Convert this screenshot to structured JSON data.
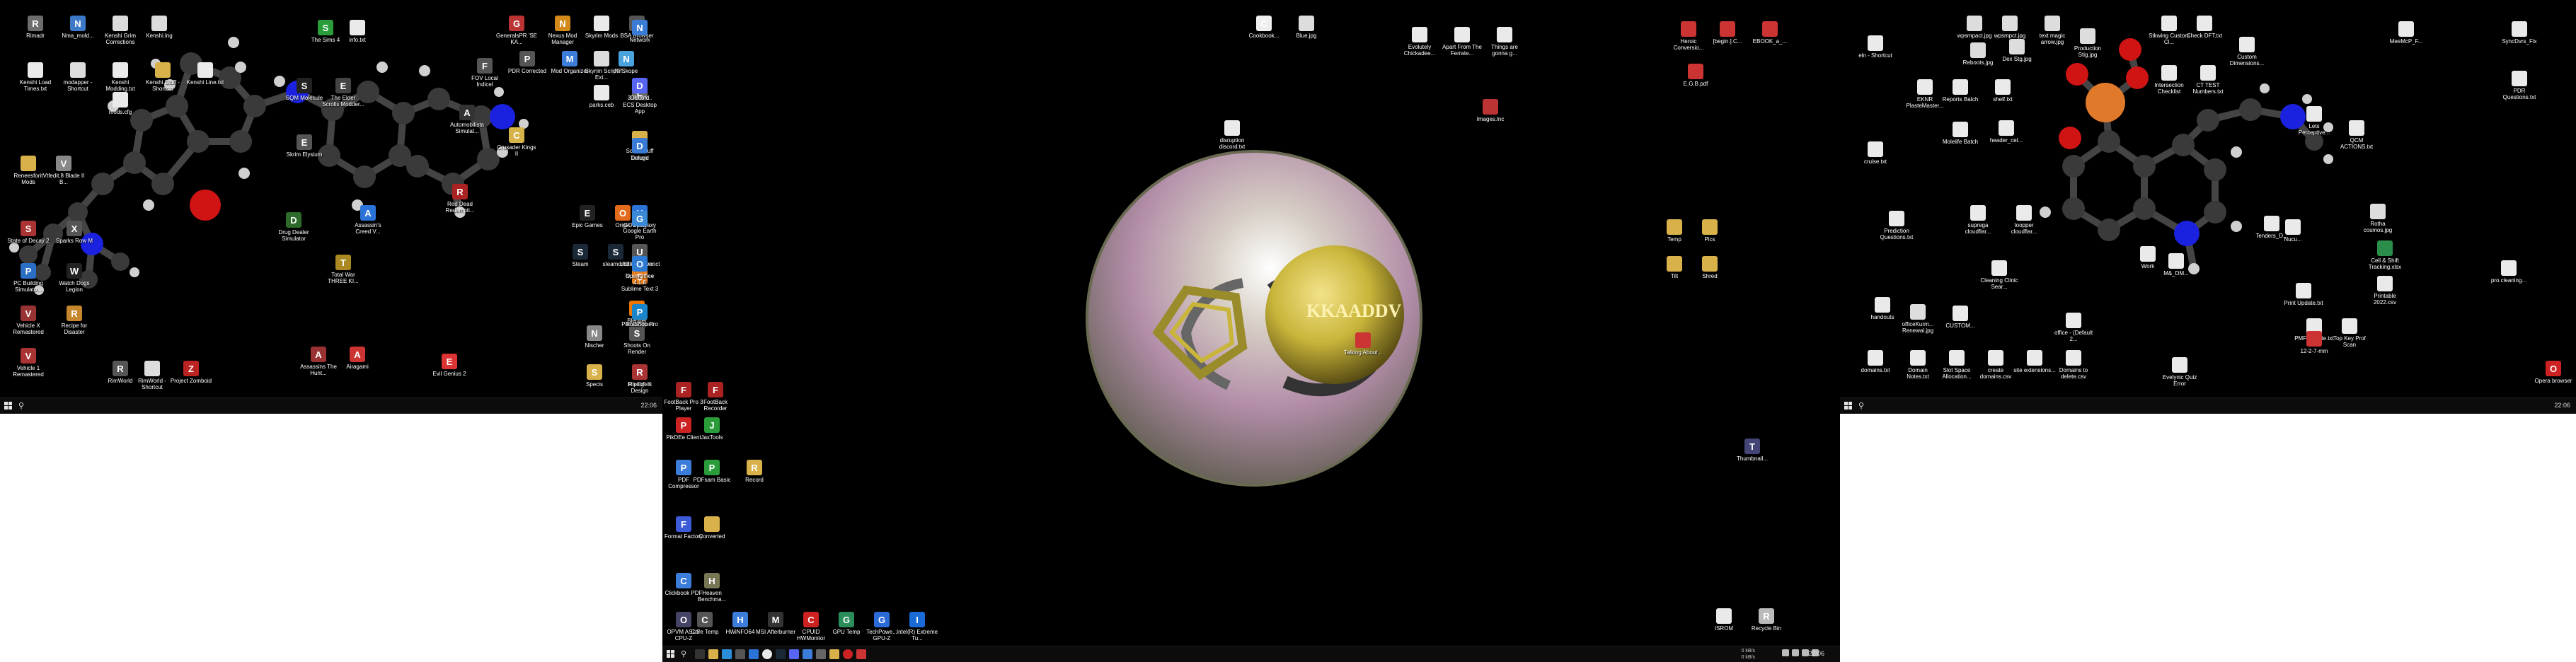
{
  "taskbars": {
    "left_clock": "22:06",
    "center_clock": "22:06",
    "right_clock": "22:06",
    "net_up": "0 kB/s",
    "net_down": "0 kB/s"
  },
  "left_icons": [
    {
      "label": "Rimadr",
      "name": "rimadr",
      "color": "#6d6d6d",
      "glyph": "R"
    },
    {
      "label": "Nma_mold...",
      "name": "nma-mold",
      "color": "#3c7ac9",
      "glyph": "N"
    },
    {
      "label": "Kenshi Grim Corrections",
      "name": "kenshi-grim",
      "color": "#dcdcdc",
      "glyph": ""
    },
    {
      "label": "Kenshi.lng",
      "name": "kenshi-lng",
      "color": "#dcdcdc",
      "glyph": ""
    },
    {
      "label": "Kenshi Load Times.txt",
      "name": "kenshi-load-times",
      "color": "#eaeaea",
      "glyph": ""
    },
    {
      "label": "modapper - Shortcut",
      "name": "modapper",
      "color": "#dcdcdc",
      "glyph": ""
    },
    {
      "label": "Kenshi Modding.txt",
      "name": "kenshi-modding",
      "color": "#eaeaea",
      "glyph": ""
    },
    {
      "label": "Kenshi Stuff - Shortcut",
      "name": "kenshi-stuff",
      "color": "#d8b14a",
      "glyph": ""
    },
    {
      "label": "Kenshi Line.txt",
      "name": "kenshi-line",
      "color": "#eaeaea",
      "glyph": ""
    },
    {
      "label": "mods.cfg",
      "name": "mods-cfg",
      "color": "#eaeaea",
      "glyph": ""
    },
    {
      "label": "Reneesforit Mods",
      "name": "reneesforit-mods",
      "color": "#d8b14a",
      "glyph": ""
    },
    {
      "label": "Vtfedit.8 Blade II B...",
      "name": "vtfedit",
      "color": "#888",
      "glyph": "V"
    },
    {
      "label": "State of Decay 2",
      "name": "state-of-decay",
      "color": "#a33",
      "glyph": "S"
    },
    {
      "label": "Sparks Row M",
      "name": "sparks-row",
      "color": "#555",
      "glyph": "X"
    },
    {
      "label": "PC Building Simulato...",
      "name": "pc-building-sim",
      "color": "#2b6fc4",
      "glyph": "P"
    },
    {
      "label": "Watch Dogs Legion",
      "name": "watch-dogs",
      "color": "#222",
      "glyph": "W"
    },
    {
      "label": "Vehicle X Remastered",
      "name": "vehicle-x",
      "color": "#933",
      "glyph": "V"
    },
    {
      "label": "Recipe for Disaster",
      "name": "recipe-disaster",
      "color": "#c6862e",
      "glyph": "R"
    },
    {
      "label": "Vehicle 1 Remastered",
      "name": "vehicle-1",
      "color": "#a33",
      "glyph": "V"
    },
    {
      "label": "RimWorld",
      "name": "rimworld",
      "color": "#555",
      "glyph": "R"
    },
    {
      "label": "RimWorld - Shortcut",
      "name": "rimworld-shortcut",
      "color": "#ddd",
      "glyph": ""
    },
    {
      "label": "Project Zomboid",
      "name": "project-zomboid",
      "color": "#b22",
      "glyph": "Z"
    },
    {
      "label": "The Sims 4",
      "name": "the-sims-4",
      "color": "#2a9d3a",
      "glyph": "S"
    },
    {
      "label": "info.txt",
      "name": "info-txt",
      "color": "#eaeaea",
      "glyph": ""
    },
    {
      "label": "SQM Molecule",
      "name": "sqm-molecule",
      "color": "#222",
      "glyph": "S"
    },
    {
      "label": "The Elder Scrolls Modder...",
      "name": "elder-scrolls",
      "color": "#444",
      "glyph": "E"
    },
    {
      "label": "Skrim Elysium",
      "name": "skrim-elysium",
      "color": "#555",
      "glyph": "E"
    },
    {
      "label": "Drug Dealer Simulator",
      "name": "drug-dealer",
      "color": "#2d6b2a",
      "glyph": "D"
    },
    {
      "label": "Assassin's Creed V...",
      "name": "assassins-creed",
      "color": "#2b73d8",
      "glyph": "A"
    },
    {
      "label": "Total War THREE KI...",
      "name": "total-war",
      "color": "#a82",
      "glyph": "T"
    },
    {
      "label": "Assassins The Hunt...",
      "name": "assassins-hunt",
      "color": "#933",
      "glyph": "A"
    },
    {
      "label": "Airagami",
      "name": "airagami",
      "color": "#c33",
      "glyph": "A"
    },
    {
      "label": "GeneralsPR 'SE KA...",
      "name": "generals-pr",
      "color": "#b33",
      "glyph": "G"
    },
    {
      "label": "Nexus Mod Manager",
      "name": "nexus-mod",
      "color": "#d48a1b",
      "glyph": "N"
    },
    {
      "label": "Skyrim Mods",
      "name": "skyrim-mods",
      "color": "#eaeaea",
      "glyph": ""
    },
    {
      "label": "BSA Browser",
      "name": "bsa-browser",
      "color": "#555",
      "glyph": "B"
    },
    {
      "label": "FOV Local Indicel",
      "name": "fov-local",
      "color": "#555",
      "glyph": "F"
    },
    {
      "label": "PDR Corrected",
      "name": "pdr-corrected",
      "color": "#555",
      "glyph": "P"
    },
    {
      "label": "Mod Organizer",
      "name": "mod-organizer",
      "color": "#3b7dd8",
      "glyph": "M"
    },
    {
      "label": "Skyrim Script Ext...",
      "name": "skyrim-script",
      "color": "#ddd",
      "glyph": ""
    },
    {
      "label": "NifSkope",
      "name": "nifskope",
      "color": "#4aa3df",
      "glyph": "N"
    },
    {
      "label": "parks.ceb",
      "name": "parks-ceb",
      "color": "#eaeaea",
      "glyph": ""
    },
    {
      "label": "Automobilista Simulat...",
      "name": "automobilista",
      "color": "#333",
      "glyph": "A"
    },
    {
      "label": "Crusader Kings II",
      "name": "crusader-kings",
      "color": "#d7b44a",
      "glyph": "C"
    },
    {
      "label": "Red Dead Redempti...",
      "name": "red-dead",
      "color": "#a22",
      "glyph": "R"
    },
    {
      "label": "Scum Stuff",
      "name": "scum-stuff",
      "color": "#d8b14a",
      "glyph": ""
    },
    {
      "label": "Network",
      "name": "network",
      "color": "#3a7bd5",
      "glyph": "N"
    },
    {
      "label": "ECS Desktop App",
      "name": "ecs-desktop",
      "color": "#666",
      "glyph": "E"
    },
    {
      "label": "3DMark...",
      "name": "3dmark",
      "color": "#334",
      "glyph": "3"
    },
    {
      "label": "Discord",
      "name": "discord",
      "color": "#5865f2",
      "glyph": "D"
    },
    {
      "label": "Tarkold",
      "name": "tarkold",
      "color": "#666",
      "glyph": "T"
    },
    {
      "label": "Deluge",
      "name": "deluge",
      "color": "#3a7bd5",
      "glyph": "D"
    },
    {
      "label": "Epic Games",
      "name": "epic",
      "color": "#222",
      "glyph": "E"
    },
    {
      "label": "Origin",
      "name": "origin",
      "color": "#e46b1c",
      "glyph": "O"
    },
    {
      "label": "GOG Galaxy",
      "name": "gog-galaxy",
      "color": "#7b3fbf",
      "glyph": "G"
    },
    {
      "label": "Uplay",
      "name": "uplay",
      "color": "#2b73d8",
      "glyph": "U"
    },
    {
      "label": "Steam",
      "name": "steam",
      "color": "#1b2838",
      "glyph": "S"
    },
    {
      "label": "steamcmd",
      "name": "steamcmd",
      "color": "#1b2838",
      "glyph": "S"
    },
    {
      "label": "Ubisoft Connect",
      "name": "ubisoft-connect",
      "color": "#2b73d8",
      "glyph": "U"
    },
    {
      "label": "Google Earth Pro",
      "name": "google-earth",
      "color": "#3b8ad8",
      "glyph": "G"
    },
    {
      "label": "UIH Viewer",
      "name": "uih-viewer",
      "color": "#555",
      "glyph": "U"
    },
    {
      "label": "Notepad++",
      "name": "notepad-pp",
      "color": "#6ab04c",
      "glyph": "N"
    },
    {
      "label": "Sublime Text 3",
      "name": "sublime",
      "color": "#e57c1e",
      "glyph": "S"
    },
    {
      "label": "OpenOffice 4.1.8",
      "name": "openoffice",
      "color": "#2e7bd6",
      "glyph": "O"
    },
    {
      "label": "Blender",
      "name": "blender",
      "color": "#ea7600",
      "glyph": "B"
    },
    {
      "label": "Nischer",
      "name": "nischer",
      "color": "#888",
      "glyph": "N"
    },
    {
      "label": "Shoots On Render",
      "name": "shoots-render",
      "color": "#555",
      "glyph": "S"
    },
    {
      "label": "TexelSpace",
      "name": "texelspace",
      "color": "#444",
      "glyph": "T"
    },
    {
      "label": "PaintShop Pro",
      "name": "paintshop",
      "color": "#1a86c9",
      "glyph": "P"
    },
    {
      "label": "Specis",
      "name": "specis",
      "color": "#d8b14a",
      "glyph": "S"
    },
    {
      "label": "Intelligent Design",
      "name": "intelligent-design",
      "color": "#777",
      "glyph": "I"
    },
    {
      "label": "Ripsoft X",
      "name": "ripsoft",
      "color": "#a33",
      "glyph": "R"
    },
    {
      "label": "Evil Genius 2",
      "name": "evil-genius",
      "color": "#d33",
      "glyph": "E"
    }
  ],
  "center_icons": [
    {
      "label": "Cookbook...",
      "name": "cookbook",
      "color": "#eee",
      "glyph": "C"
    },
    {
      "label": "Blue.jpg",
      "name": "blue-jpg",
      "color": "#ddd",
      "glyph": ""
    },
    {
      "label": "Evolutely Chickadee...",
      "name": "evolutely",
      "color": "#eaeaea",
      "glyph": ""
    },
    {
      "label": "Apart From The Ferrate...",
      "name": "apart-from",
      "color": "#eaeaea",
      "glyph": ""
    },
    {
      "label": "Things are gonna g...",
      "name": "things-gonna",
      "color": "#eaeaea",
      "glyph": ""
    },
    {
      "label": "Heroic Conversio...",
      "name": "heroic-conversion",
      "color": "#c33",
      "glyph": ""
    },
    {
      "label": "[begin.].C...",
      "name": "begin-c",
      "color": "#c33",
      "glyph": ""
    },
    {
      "label": "EBOOK_a_...",
      "name": "ebook",
      "color": "#c33",
      "glyph": ""
    },
    {
      "label": "E.G.B.pdf",
      "name": "egb-pdf",
      "color": "#c33",
      "glyph": ""
    },
    {
      "label": "Images.lnc",
      "name": "images-lnc",
      "color": "#b33",
      "glyph": ""
    },
    {
      "label": "disruption discord.txt",
      "name": "disruption-discord",
      "color": "#eaeaea",
      "glyph": ""
    },
    {
      "label": "Talking About...",
      "name": "talking-about",
      "color": "#c33",
      "glyph": ""
    },
    {
      "label": "Temp",
      "name": "temp",
      "color": "#d8b14a",
      "glyph": ""
    },
    {
      "label": "Pics",
      "name": "pics",
      "color": "#d8b14a",
      "glyph": ""
    },
    {
      "label": "Tilt",
      "name": "tilt",
      "color": "#d8b14a",
      "glyph": ""
    },
    {
      "label": "Shred",
      "name": "shred",
      "color": "#d8b14a",
      "glyph": ""
    },
    {
      "label": "PikDEe Client",
      "name": "pikdee",
      "color": "#c22",
      "glyph": "P"
    },
    {
      "label": "JaxTools",
      "name": "jaxtools",
      "color": "#2a9d3a",
      "glyph": "J"
    },
    {
      "label": "PDF Compressor",
      "name": "pdf-compressor",
      "color": "#3b7dd8",
      "glyph": "P"
    },
    {
      "label": "PDFsam Basic",
      "name": "pdfsam",
      "color": "#2a9d3a",
      "glyph": "P"
    },
    {
      "label": "Record",
      "name": "record",
      "color": "#d8b14a",
      "glyph": "R"
    },
    {
      "label": "Format Factory",
      "name": "format-factory",
      "color": "#3b5bd8",
      "glyph": "F"
    },
    {
      "label": "Converted",
      "name": "converted",
      "color": "#d8b14a",
      "glyph": ""
    },
    {
      "label": "Clickbook PDF",
      "name": "clickbook",
      "color": "#3b7dd8",
      "glyph": "C"
    },
    {
      "label": "Heaven Benchma...",
      "name": "heaven-bench",
      "color": "#775",
      "glyph": "H"
    },
    {
      "label": "OPVM ASUS CPU-Z",
      "name": "opvm-cpuz",
      "color": "#446",
      "glyph": "O"
    },
    {
      "label": "Core Temp",
      "name": "core-temp",
      "color": "#555",
      "glyph": "C"
    },
    {
      "label": "HWiNFO64",
      "name": "hwinfo",
      "color": "#3b7dd8",
      "glyph": "H"
    },
    {
      "label": "MSI Afterburner",
      "name": "msi-afterburner",
      "color": "#333",
      "glyph": "M"
    },
    {
      "label": "CPUID HWMonitor",
      "name": "cpuid-hwmonitor",
      "color": "#c22",
      "glyph": "C"
    },
    {
      "label": "GPU Temp",
      "name": "gpu-temp",
      "color": "#2a8d5a",
      "glyph": "G"
    },
    {
      "label": "TechPowe... GPU-Z",
      "name": "techpowerup",
      "color": "#2a6bd8",
      "glyph": "G"
    },
    {
      "label": "Intel(R) Extreme Tu...",
      "name": "intel-xtu",
      "color": "#1a6bd8",
      "glyph": "I"
    },
    {
      "label": "Thumbnail...",
      "name": "thumbnail",
      "color": "#447",
      "glyph": "T"
    },
    {
      "label": "ISROM",
      "name": "isrom",
      "color": "#eaeaea",
      "glyph": ""
    },
    {
      "label": "Recycle Bin",
      "name": "recycle-bin",
      "color": "#bbb",
      "glyph": "R"
    },
    {
      "label": "FootBack Pro 3 Player",
      "name": "footback-player",
      "color": "#a22",
      "glyph": "F"
    },
    {
      "label": "FootBack Recorder",
      "name": "footback-recorder",
      "color": "#a22",
      "glyph": "F"
    }
  ],
  "right_icons": [
    {
      "label": "eln - Shortcut",
      "name": "eln-shortcut",
      "color": "#eaeaea",
      "glyph": ""
    },
    {
      "label": "wpsmpact.jpg",
      "name": "wpsmpact",
      "color": "#ddd",
      "glyph": ""
    },
    {
      "label": "wpsmpct.jpg",
      "name": "wpsmpct",
      "color": "#ddd",
      "glyph": ""
    },
    {
      "label": "text magic arrow.jpg",
      "name": "text-magic",
      "color": "#ddd",
      "glyph": ""
    },
    {
      "label": "Production Stig.jpg",
      "name": "production-stig",
      "color": "#ddd",
      "glyph": ""
    },
    {
      "label": "Stkwing Custom Cl...",
      "name": "stkwing",
      "color": "#eaeaea",
      "glyph": ""
    },
    {
      "label": "Check DFT.txt",
      "name": "check-dft",
      "color": "#eaeaea",
      "glyph": ""
    },
    {
      "label": "Custom Dimensions...",
      "name": "custom-dimensions",
      "color": "#eaeaea",
      "glyph": ""
    },
    {
      "label": "Reboots.jpg",
      "name": "reboots",
      "color": "#ddd",
      "glyph": ""
    },
    {
      "label": "Dex Stg.jpg",
      "name": "dex-stg",
      "color": "#ddd",
      "glyph": ""
    },
    {
      "label": "MeeMcP_F...",
      "name": "meemcp",
      "color": "#eaeaea",
      "glyph": ""
    },
    {
      "label": "SyncDvrs_Fix",
      "name": "syncdvrs",
      "color": "#eaeaea",
      "glyph": ""
    },
    {
      "label": "Intersection Checklist",
      "name": "intersection",
      "color": "#eaeaea",
      "glyph": ""
    },
    {
      "label": "CT TEST Numbers.txt",
      "name": "ct-test",
      "color": "#eaeaea",
      "glyph": ""
    },
    {
      "label": "PDR Questions.txt",
      "name": "pdr-questions",
      "color": "#eaeaea",
      "glyph": ""
    },
    {
      "label": "EKNR PlasteMaster...",
      "name": "eknr",
      "color": "#eaeaea",
      "glyph": ""
    },
    {
      "label": "Reports Batch",
      "name": "reports-batch",
      "color": "#eaeaea",
      "glyph": ""
    },
    {
      "label": "shelf.txt",
      "name": "shelf-txt",
      "color": "#eaeaea",
      "glyph": ""
    },
    {
      "label": "Molelife Batch",
      "name": "molelife",
      "color": "#eaeaea",
      "glyph": ""
    },
    {
      "label": "header_cel...",
      "name": "header-cel",
      "color": "#eaeaea",
      "glyph": ""
    },
    {
      "label": "Lets Perceptive...",
      "name": "lets-perceptive",
      "color": "#eaeaea",
      "glyph": ""
    },
    {
      "label": "QCM ACTIONS.txt",
      "name": "qcm-actions",
      "color": "#eaeaea",
      "glyph": ""
    },
    {
      "label": "cruise.txt",
      "name": "cruise-txt",
      "color": "#eaeaea",
      "glyph": ""
    },
    {
      "label": "Prediction Questions.txt",
      "name": "prediction-questions",
      "color": "#eaeaea",
      "glyph": ""
    },
    {
      "label": "suprega cloudflar...",
      "name": "suprega",
      "color": "#eaeaea",
      "glyph": ""
    },
    {
      "label": "toopper cloudflar...",
      "name": "toopper",
      "color": "#eaeaea",
      "glyph": ""
    },
    {
      "label": "Tenders_D...",
      "name": "tenders",
      "color": "#eaeaea",
      "glyph": ""
    },
    {
      "label": "Nucu...",
      "name": "nucu",
      "color": "#eaeaea",
      "glyph": ""
    },
    {
      "label": "Rotha cosmos.jpg",
      "name": "rotha-cosmos",
      "color": "#ddd",
      "glyph": ""
    },
    {
      "label": "Cleaning Clinic Sear...",
      "name": "cleaning-clinic",
      "color": "#eaeaea",
      "glyph": ""
    },
    {
      "label": "Work",
      "name": "work",
      "color": "#eaeaea",
      "glyph": ""
    },
    {
      "label": "M&_DM...",
      "name": "m-dm",
      "color": "#eaeaea",
      "glyph": ""
    },
    {
      "label": "Cell & Shift Tracking.xlsx",
      "name": "cell-shift",
      "color": "#2a8d4a",
      "glyph": ""
    },
    {
      "label": "pro.cleaning...",
      "name": "pro-cleaning",
      "color": "#eaeaea",
      "glyph": ""
    },
    {
      "label": "Printable 2022.csv",
      "name": "printable-2022",
      "color": "#eaeaea",
      "glyph": ""
    },
    {
      "label": "Print Update.txt",
      "name": "print-update",
      "color": "#eaeaea",
      "glyph": ""
    },
    {
      "label": "handouts",
      "name": "handouts",
      "color": "#eaeaea",
      "glyph": ""
    },
    {
      "label": "officeKurm... Renewal.jpg",
      "name": "office-kurm",
      "color": "#ddd",
      "glyph": ""
    },
    {
      "label": "CUSTOM...",
      "name": "custom-x",
      "color": "#eaeaea",
      "glyph": ""
    },
    {
      "label": "office - (Default 2...",
      "name": "office-default",
      "color": "#eaeaea",
      "glyph": ""
    },
    {
      "label": "PMF Update.txt",
      "name": "pmf-update",
      "color": "#eaeaea",
      "glyph": ""
    },
    {
      "label": "Top Key Prof Scan",
      "name": "top-key-prof",
      "color": "#eaeaea",
      "glyph": ""
    },
    {
      "label": "domains.txt",
      "name": "domains-txt",
      "color": "#eaeaea",
      "glyph": ""
    },
    {
      "label": "Domain Notes.txt",
      "name": "domain-notes",
      "color": "#eaeaea",
      "glyph": ""
    },
    {
      "label": "Slot Space Allocation...",
      "name": "slot-space",
      "color": "#eaeaea",
      "glyph": ""
    },
    {
      "label": "create domains.csv",
      "name": "create-domains",
      "color": "#eaeaea",
      "glyph": ""
    },
    {
      "label": "site extensions...",
      "name": "site-extensions",
      "color": "#eaeaea",
      "glyph": ""
    },
    {
      "label": "Domains to delete.csv",
      "name": "domains-delete",
      "color": "#eaeaea",
      "glyph": ""
    },
    {
      "label": "Evelynic Quiz Error",
      "name": "evelynic-quiz",
      "color": "#eaeaea",
      "glyph": ""
    },
    {
      "label": "12-2-7-mm",
      "name": "12-2-7-mm",
      "color": "#c33",
      "glyph": ""
    },
    {
      "label": "Opera browser",
      "name": "opera-browser",
      "color": "#c22",
      "glyph": "O"
    }
  ],
  "wallpaper": {
    "ball_text": "KKAADDV",
    "colors": {
      "carbon": "#3a3a3a",
      "nitrogen": "#1a22e0",
      "oxygen": "#d01414",
      "hydrogen": "#d0d0d0",
      "ball_gold": "#c9b53a"
    }
  }
}
